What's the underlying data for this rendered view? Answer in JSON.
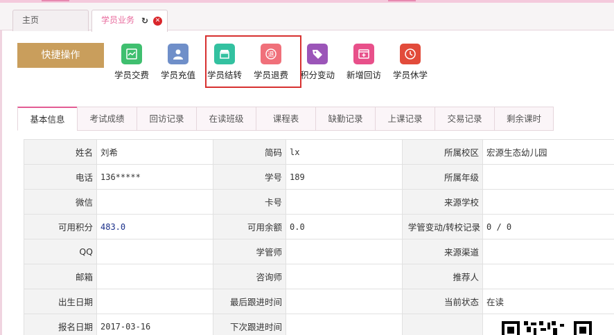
{
  "page_tabs": [
    {
      "label": "主页"
    },
    {
      "label": "学员业务"
    }
  ],
  "quick_actions": {
    "title": "快捷操作",
    "items": [
      {
        "label": "学员交费",
        "icon": "payment-icon",
        "color": "#3fbf6f"
      },
      {
        "label": "学员充值",
        "icon": "user-recharge-icon",
        "color": "#6f8fc9"
      },
      {
        "label": "学员结转",
        "icon": "store-icon",
        "color": "#33c1a0"
      },
      {
        "label": "学员退费",
        "icon": "refund-icon",
        "color": "#f0707a"
      },
      {
        "label": "积分变动",
        "icon": "tag-icon",
        "color": "#9b55b8"
      },
      {
        "label": "新增回访",
        "icon": "add-visit-icon",
        "color": "#e8508a"
      },
      {
        "label": "学员休学",
        "icon": "clock-icon",
        "color": "#e24b3b"
      }
    ]
  },
  "info_tabs": [
    "基本信息",
    "考试成绩",
    "回访记录",
    "在读班级",
    "课程表",
    "缺勤记录",
    "上课记录",
    "交易记录",
    "剩余课时"
  ],
  "details": {
    "rows": [
      [
        {
          "label": "姓名",
          "value": "刘希"
        },
        {
          "label": "简码",
          "value": "lx"
        },
        {
          "label": "所属校区",
          "value": "宏源生态幼儿园"
        }
      ],
      [
        {
          "label": "电话",
          "value": "136*****"
        },
        {
          "label": "学号",
          "value": "189"
        },
        {
          "label": "所属年级",
          "value": ""
        }
      ],
      [
        {
          "label": "微信",
          "value": ""
        },
        {
          "label": "卡号",
          "value": ""
        },
        {
          "label": "来源学校",
          "value": ""
        }
      ],
      [
        {
          "label": "可用积分",
          "value": "483.0"
        },
        {
          "label": "可用余额",
          "value": "0.0"
        },
        {
          "label": "学管变动/转校记录",
          "value": "0 / 0"
        }
      ],
      [
        {
          "label": "QQ",
          "value": ""
        },
        {
          "label": "学管师",
          "value": ""
        },
        {
          "label": "来源渠道",
          "value": ""
        }
      ],
      [
        {
          "label": "邮箱",
          "value": ""
        },
        {
          "label": "咨询师",
          "value": ""
        },
        {
          "label": "推荐人",
          "value": ""
        }
      ],
      [
        {
          "label": "出生日期",
          "value": ""
        },
        {
          "label": "最后跟进时间",
          "value": ""
        },
        {
          "label": "当前状态",
          "value": "在读"
        }
      ],
      [
        {
          "label": "报名日期",
          "value": "2017-03-16"
        },
        {
          "label": "下次跟进时间",
          "value": ""
        },
        {
          "label": "",
          "value": ""
        }
      ]
    ]
  }
}
